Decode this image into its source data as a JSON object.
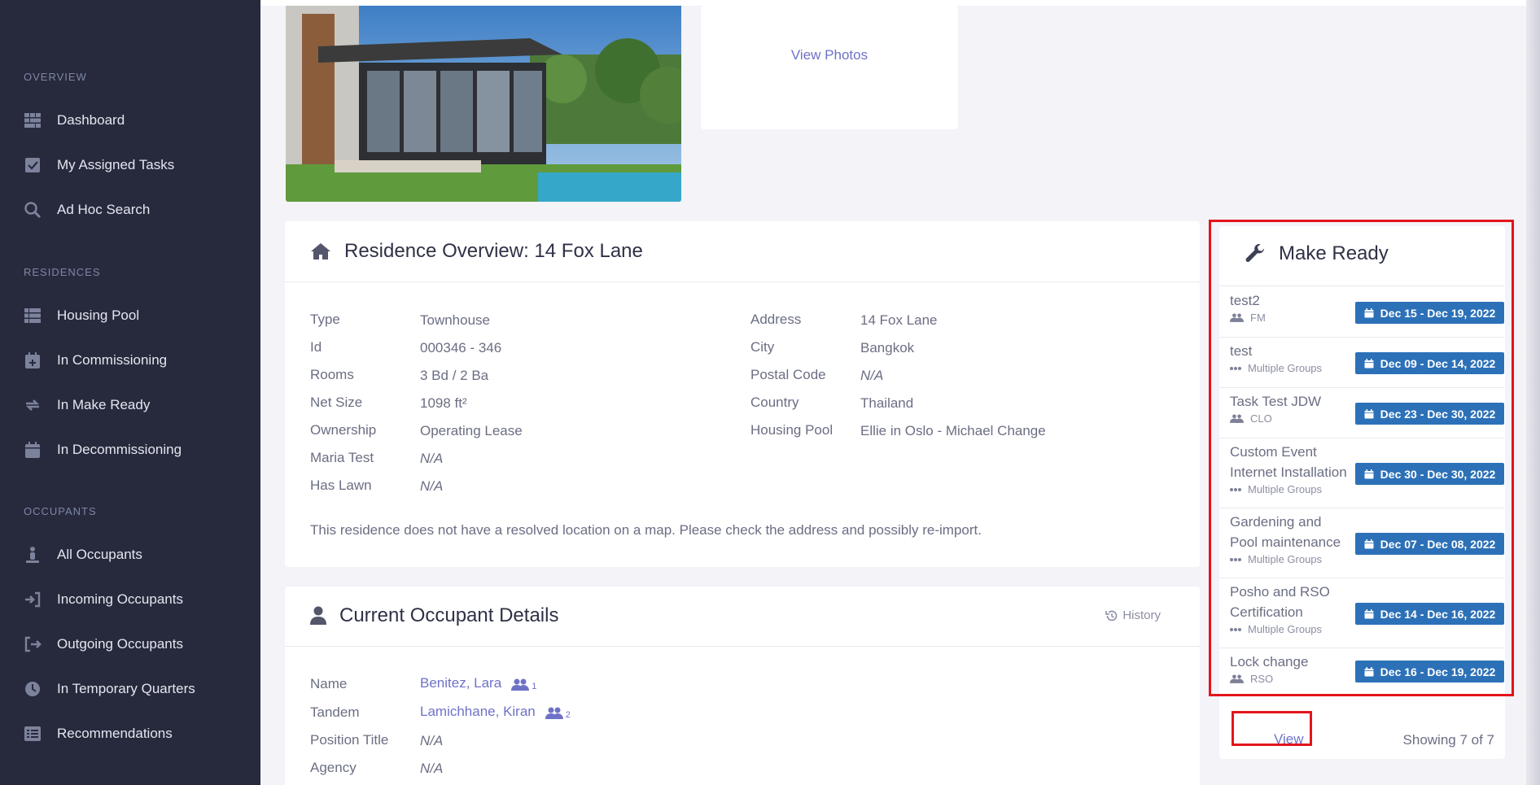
{
  "sidebar": {
    "sections": {
      "overview": "OVERVIEW",
      "residences": "RESIDENCES",
      "occupants": "OCCUPANTS"
    },
    "items": [
      {
        "label": "Dashboard",
        "icon": "dashboard-icon"
      },
      {
        "label": "My Assigned Tasks",
        "icon": "checkbox-icon"
      },
      {
        "label": "Ad Hoc Search",
        "icon": "search-icon"
      },
      {
        "label": "Housing Pool",
        "icon": "list-icon"
      },
      {
        "label": "In Commissioning",
        "icon": "calendar-plus-icon"
      },
      {
        "label": "In Make Ready",
        "icon": "refresh-icon"
      },
      {
        "label": "In Decommissioning",
        "icon": "calendar-icon"
      },
      {
        "label": "All Occupants",
        "icon": "person-icon"
      },
      {
        "label": "Incoming Occupants",
        "icon": "sign-in-icon"
      },
      {
        "label": "Outgoing Occupants",
        "icon": "sign-out-icon"
      },
      {
        "label": "In Temporary Quarters",
        "icon": "clock-icon"
      },
      {
        "label": "Recommendations",
        "icon": "list-alt-icon"
      }
    ]
  },
  "photos": {
    "view_photos": "View Photos"
  },
  "overview": {
    "title": "Residence Overview: 14 Fox Lane",
    "left": [
      {
        "label": "Type",
        "value": "Townhouse"
      },
      {
        "label": "Id",
        "value": "000346 - 346"
      },
      {
        "label": "Rooms",
        "value": "3 Bd / 2 Ba"
      },
      {
        "label": "Net Size",
        "value": "1098 ft²"
      },
      {
        "label": "Ownership",
        "value": "Operating Lease"
      },
      {
        "label": "Maria Test",
        "value": "N/A"
      },
      {
        "label": "Has Lawn",
        "value": "N/A"
      }
    ],
    "right": [
      {
        "label": "Address",
        "value": "14 Fox Lane"
      },
      {
        "label": "City",
        "value": "Bangkok"
      },
      {
        "label": "Postal Code",
        "value": "N/A"
      },
      {
        "label": "Country",
        "value": "Thailand"
      },
      {
        "label": "Housing Pool",
        "value": "Ellie in Oslo - Michael Change"
      }
    ],
    "note": "This residence does not have a resolved location on a map. Please check the address and possibly re-import."
  },
  "occupant": {
    "title": "Current Occupant Details",
    "history": "History",
    "rows": [
      {
        "label": "Name",
        "value": "Benitez, Lara",
        "count": "1"
      },
      {
        "label": "Tandem",
        "value": "Lamichhane, Kiran",
        "count": "2"
      },
      {
        "label": "Position Title",
        "value": "N/A"
      },
      {
        "label": "Agency",
        "value": "N/A"
      }
    ]
  },
  "make_ready": {
    "title": "Make Ready",
    "tasks": [
      {
        "name": [
          "test2"
        ],
        "group": "FM",
        "group_icon": "users-icon",
        "dates": "Dec 15 - Dec 19, 2022"
      },
      {
        "name": [
          "test"
        ],
        "group": "Multiple Groups",
        "group_icon": "ellipsis-icon",
        "dates": "Dec 09 - Dec 14, 2022"
      },
      {
        "name": [
          "Task Test JDW"
        ],
        "group": "CLO",
        "group_icon": "users-icon",
        "dates": "Dec 23 - Dec 30, 2022"
      },
      {
        "name": [
          "Custom Event",
          "Internet Installation"
        ],
        "group": "Multiple Groups",
        "group_icon": "ellipsis-icon",
        "dates": "Dec 30 - Dec 30, 2022"
      },
      {
        "name": [
          "Gardening and",
          "Pool maintenance"
        ],
        "group": "Multiple Groups",
        "group_icon": "ellipsis-icon",
        "dates": "Dec 07 - Dec 08, 2022"
      },
      {
        "name": [
          "Posho and RSO",
          "Certification"
        ],
        "group": "Multiple Groups",
        "group_icon": "ellipsis-icon",
        "dates": "Dec 14 - Dec 16, 2022"
      },
      {
        "name": [
          "Lock change"
        ],
        "group": "RSO",
        "group_icon": "users-icon",
        "dates": "Dec 16 - Dec 19, 2022"
      }
    ],
    "view": "View",
    "showing": "Showing 7 of 7"
  },
  "colors": {
    "sidebar_bg": "#262a3c",
    "accent_link": "#6e72c7",
    "badge_blue": "#2c71b8",
    "highlight_red": "#e3141c"
  }
}
